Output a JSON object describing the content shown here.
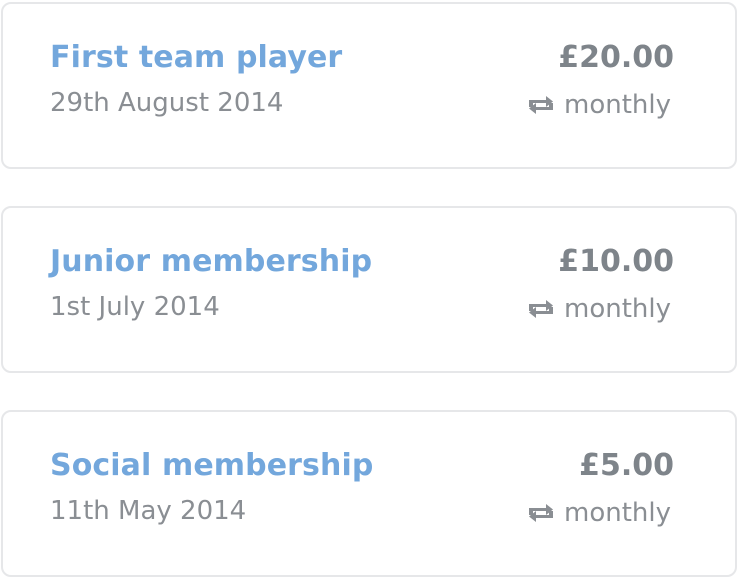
{
  "colors": {
    "title": "#73a7dc",
    "price": "#7e848a",
    "secondary_text": "#8a8e93",
    "card_border": "#e6e7e9"
  },
  "memberships": [
    {
      "name": "First team player",
      "date": "29th August 2014",
      "price": "£20.00",
      "frequency": "monthly",
      "frequency_icon": "repeat-icon"
    },
    {
      "name": "Junior membership",
      "date": "1st July 2014",
      "price": "£10.00",
      "frequency": "monthly",
      "frequency_icon": "repeat-icon"
    },
    {
      "name": "Social membership",
      "date": "11th May 2014",
      "price": "£5.00",
      "frequency": "monthly",
      "frequency_icon": "repeat-icon"
    }
  ]
}
